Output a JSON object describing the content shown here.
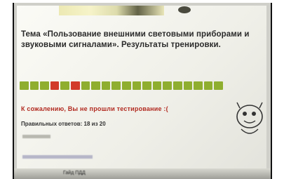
{
  "title": "Тема «Пользование внешними световыми приборами и звуковыми сигналами». Результаты тренировки.",
  "progress": {
    "cells": [
      {
        "status": "correct",
        "color": "#8fae2f"
      },
      {
        "status": "correct",
        "color": "#8fae2f"
      },
      {
        "status": "correct",
        "color": "#8fae2f"
      },
      {
        "status": "wrong",
        "color": "#d23a2a"
      },
      {
        "status": "correct",
        "color": "#8fae2f"
      },
      {
        "status": "wrong",
        "color": "#d23a2a"
      },
      {
        "status": "correct",
        "color": "#8fae2f"
      },
      {
        "status": "correct",
        "color": "#8fae2f"
      },
      {
        "status": "correct",
        "color": "#8fae2f"
      },
      {
        "status": "correct",
        "color": "#8fae2f"
      },
      {
        "status": "correct",
        "color": "#8fae2f"
      },
      {
        "status": "correct",
        "color": "#8fae2f"
      },
      {
        "status": "correct",
        "color": "#8fae2f"
      },
      {
        "status": "correct",
        "color": "#8fae2f"
      },
      {
        "status": "correct",
        "color": "#8fae2f"
      },
      {
        "status": "correct",
        "color": "#8fae2f"
      },
      {
        "status": "correct",
        "color": "#8fae2f"
      },
      {
        "status": "correct",
        "color": "#8fae2f"
      },
      {
        "status": "correct",
        "color": "#8fae2f"
      },
      {
        "status": "correct",
        "color": "#8fae2f"
      }
    ]
  },
  "result": {
    "fail_message": "К сожалению, Вы не прошли тестирование :(",
    "correct_answers": "Правильных ответов: 18 из 20"
  },
  "taskbar": {
    "text": "Гайд ПДД"
  },
  "colors": {
    "accent_correct": "#8fae2f",
    "accent_wrong": "#d23a2a",
    "fail_text": "#b22a20"
  }
}
